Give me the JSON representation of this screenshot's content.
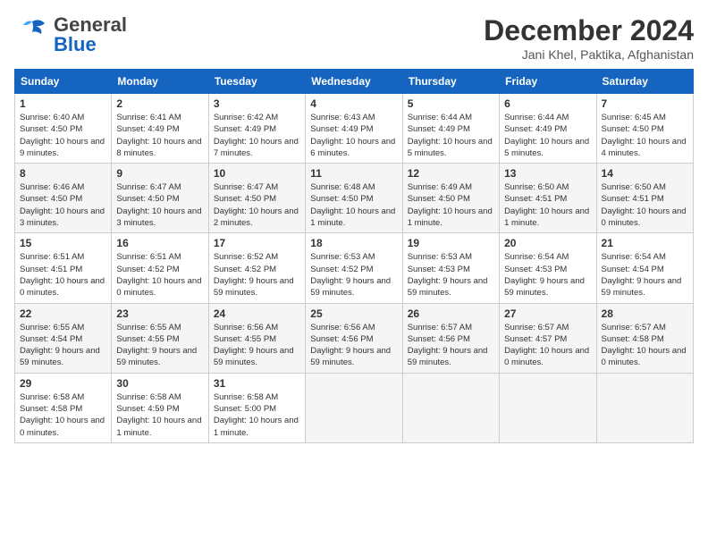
{
  "header": {
    "logo_general": "General",
    "logo_blue": "Blue",
    "month_title": "December 2024",
    "location": "Jani Khel, Paktika, Afghanistan"
  },
  "calendar": {
    "days_of_week": [
      "Sunday",
      "Monday",
      "Tuesday",
      "Wednesday",
      "Thursday",
      "Friday",
      "Saturday"
    ],
    "weeks": [
      [
        {
          "day": "1",
          "sunrise": "Sunrise: 6:40 AM",
          "sunset": "Sunset: 4:50 PM",
          "daylight": "Daylight: 10 hours and 9 minutes."
        },
        {
          "day": "2",
          "sunrise": "Sunrise: 6:41 AM",
          "sunset": "Sunset: 4:49 PM",
          "daylight": "Daylight: 10 hours and 8 minutes."
        },
        {
          "day": "3",
          "sunrise": "Sunrise: 6:42 AM",
          "sunset": "Sunset: 4:49 PM",
          "daylight": "Daylight: 10 hours and 7 minutes."
        },
        {
          "day": "4",
          "sunrise": "Sunrise: 6:43 AM",
          "sunset": "Sunset: 4:49 PM",
          "daylight": "Daylight: 10 hours and 6 minutes."
        },
        {
          "day": "5",
          "sunrise": "Sunrise: 6:44 AM",
          "sunset": "Sunset: 4:49 PM",
          "daylight": "Daylight: 10 hours and 5 minutes."
        },
        {
          "day": "6",
          "sunrise": "Sunrise: 6:44 AM",
          "sunset": "Sunset: 4:49 PM",
          "daylight": "Daylight: 10 hours and 5 minutes."
        },
        {
          "day": "7",
          "sunrise": "Sunrise: 6:45 AM",
          "sunset": "Sunset: 4:50 PM",
          "daylight": "Daylight: 10 hours and 4 minutes."
        }
      ],
      [
        {
          "day": "8",
          "sunrise": "Sunrise: 6:46 AM",
          "sunset": "Sunset: 4:50 PM",
          "daylight": "Daylight: 10 hours and 3 minutes."
        },
        {
          "day": "9",
          "sunrise": "Sunrise: 6:47 AM",
          "sunset": "Sunset: 4:50 PM",
          "daylight": "Daylight: 10 hours and 3 minutes."
        },
        {
          "day": "10",
          "sunrise": "Sunrise: 6:47 AM",
          "sunset": "Sunset: 4:50 PM",
          "daylight": "Daylight: 10 hours and 2 minutes."
        },
        {
          "day": "11",
          "sunrise": "Sunrise: 6:48 AM",
          "sunset": "Sunset: 4:50 PM",
          "daylight": "Daylight: 10 hours and 1 minute."
        },
        {
          "day": "12",
          "sunrise": "Sunrise: 6:49 AM",
          "sunset": "Sunset: 4:50 PM",
          "daylight": "Daylight: 10 hours and 1 minute."
        },
        {
          "day": "13",
          "sunrise": "Sunrise: 6:50 AM",
          "sunset": "Sunset: 4:51 PM",
          "daylight": "Daylight: 10 hours and 1 minute."
        },
        {
          "day": "14",
          "sunrise": "Sunrise: 6:50 AM",
          "sunset": "Sunset: 4:51 PM",
          "daylight": "Daylight: 10 hours and 0 minutes."
        }
      ],
      [
        {
          "day": "15",
          "sunrise": "Sunrise: 6:51 AM",
          "sunset": "Sunset: 4:51 PM",
          "daylight": "Daylight: 10 hours and 0 minutes."
        },
        {
          "day": "16",
          "sunrise": "Sunrise: 6:51 AM",
          "sunset": "Sunset: 4:52 PM",
          "daylight": "Daylight: 10 hours and 0 minutes."
        },
        {
          "day": "17",
          "sunrise": "Sunrise: 6:52 AM",
          "sunset": "Sunset: 4:52 PM",
          "daylight": "Daylight: 9 hours and 59 minutes."
        },
        {
          "day": "18",
          "sunrise": "Sunrise: 6:53 AM",
          "sunset": "Sunset: 4:52 PM",
          "daylight": "Daylight: 9 hours and 59 minutes."
        },
        {
          "day": "19",
          "sunrise": "Sunrise: 6:53 AM",
          "sunset": "Sunset: 4:53 PM",
          "daylight": "Daylight: 9 hours and 59 minutes."
        },
        {
          "day": "20",
          "sunrise": "Sunrise: 6:54 AM",
          "sunset": "Sunset: 4:53 PM",
          "daylight": "Daylight: 9 hours and 59 minutes."
        },
        {
          "day": "21",
          "sunrise": "Sunrise: 6:54 AM",
          "sunset": "Sunset: 4:54 PM",
          "daylight": "Daylight: 9 hours and 59 minutes."
        }
      ],
      [
        {
          "day": "22",
          "sunrise": "Sunrise: 6:55 AM",
          "sunset": "Sunset: 4:54 PM",
          "daylight": "Daylight: 9 hours and 59 minutes."
        },
        {
          "day": "23",
          "sunrise": "Sunrise: 6:55 AM",
          "sunset": "Sunset: 4:55 PM",
          "daylight": "Daylight: 9 hours and 59 minutes."
        },
        {
          "day": "24",
          "sunrise": "Sunrise: 6:56 AM",
          "sunset": "Sunset: 4:55 PM",
          "daylight": "Daylight: 9 hours and 59 minutes."
        },
        {
          "day": "25",
          "sunrise": "Sunrise: 6:56 AM",
          "sunset": "Sunset: 4:56 PM",
          "daylight": "Daylight: 9 hours and 59 minutes."
        },
        {
          "day": "26",
          "sunrise": "Sunrise: 6:57 AM",
          "sunset": "Sunset: 4:56 PM",
          "daylight": "Daylight: 9 hours and 59 minutes."
        },
        {
          "day": "27",
          "sunrise": "Sunrise: 6:57 AM",
          "sunset": "Sunset: 4:57 PM",
          "daylight": "Daylight: 10 hours and 0 minutes."
        },
        {
          "day": "28",
          "sunrise": "Sunrise: 6:57 AM",
          "sunset": "Sunset: 4:58 PM",
          "daylight": "Daylight: 10 hours and 0 minutes."
        }
      ],
      [
        {
          "day": "29",
          "sunrise": "Sunrise: 6:58 AM",
          "sunset": "Sunset: 4:58 PM",
          "daylight": "Daylight: 10 hours and 0 minutes."
        },
        {
          "day": "30",
          "sunrise": "Sunrise: 6:58 AM",
          "sunset": "Sunset: 4:59 PM",
          "daylight": "Daylight: 10 hours and 1 minute."
        },
        {
          "day": "31",
          "sunrise": "Sunrise: 6:58 AM",
          "sunset": "Sunset: 5:00 PM",
          "daylight": "Daylight: 10 hours and 1 minute."
        },
        null,
        null,
        null,
        null
      ]
    ]
  }
}
